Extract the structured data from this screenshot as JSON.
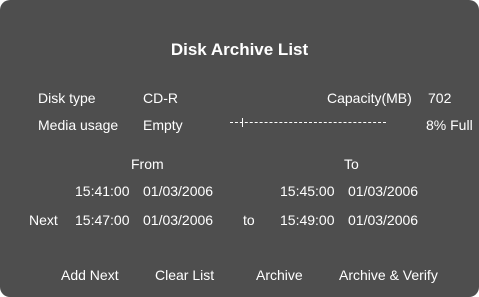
{
  "dialog": {
    "title": "Disk Archive List"
  },
  "disk_info": {
    "disk_type_label": "Disk type",
    "disk_type_value": "CD-R",
    "capacity_label": "Capacity(MB)",
    "capacity_value": "702",
    "media_usage_label": "Media usage",
    "media_usage_value": "Empty",
    "usage_percent_text": "8% Full",
    "usage_fraction": 0.08
  },
  "range": {
    "from_header": "From",
    "to_header": "To",
    "current_from_time": "15:41:00",
    "current_from_date": "01/03/2006",
    "current_to_time": "15:45:00",
    "current_to_date": "01/03/2006",
    "next_label": "Next",
    "next_from_time": "15:47:00",
    "next_from_date": "01/03/2006",
    "next_to_label": "to",
    "next_to_time": "15:49:00",
    "next_to_date": "01/03/2006"
  },
  "buttons": {
    "add_next": "Add Next",
    "clear_list": "Clear List",
    "archive": "Archive",
    "archive_verify": "Archive & Verify"
  },
  "colors": {
    "panel_background": "#4e4e4e",
    "text": "#ffffff"
  }
}
